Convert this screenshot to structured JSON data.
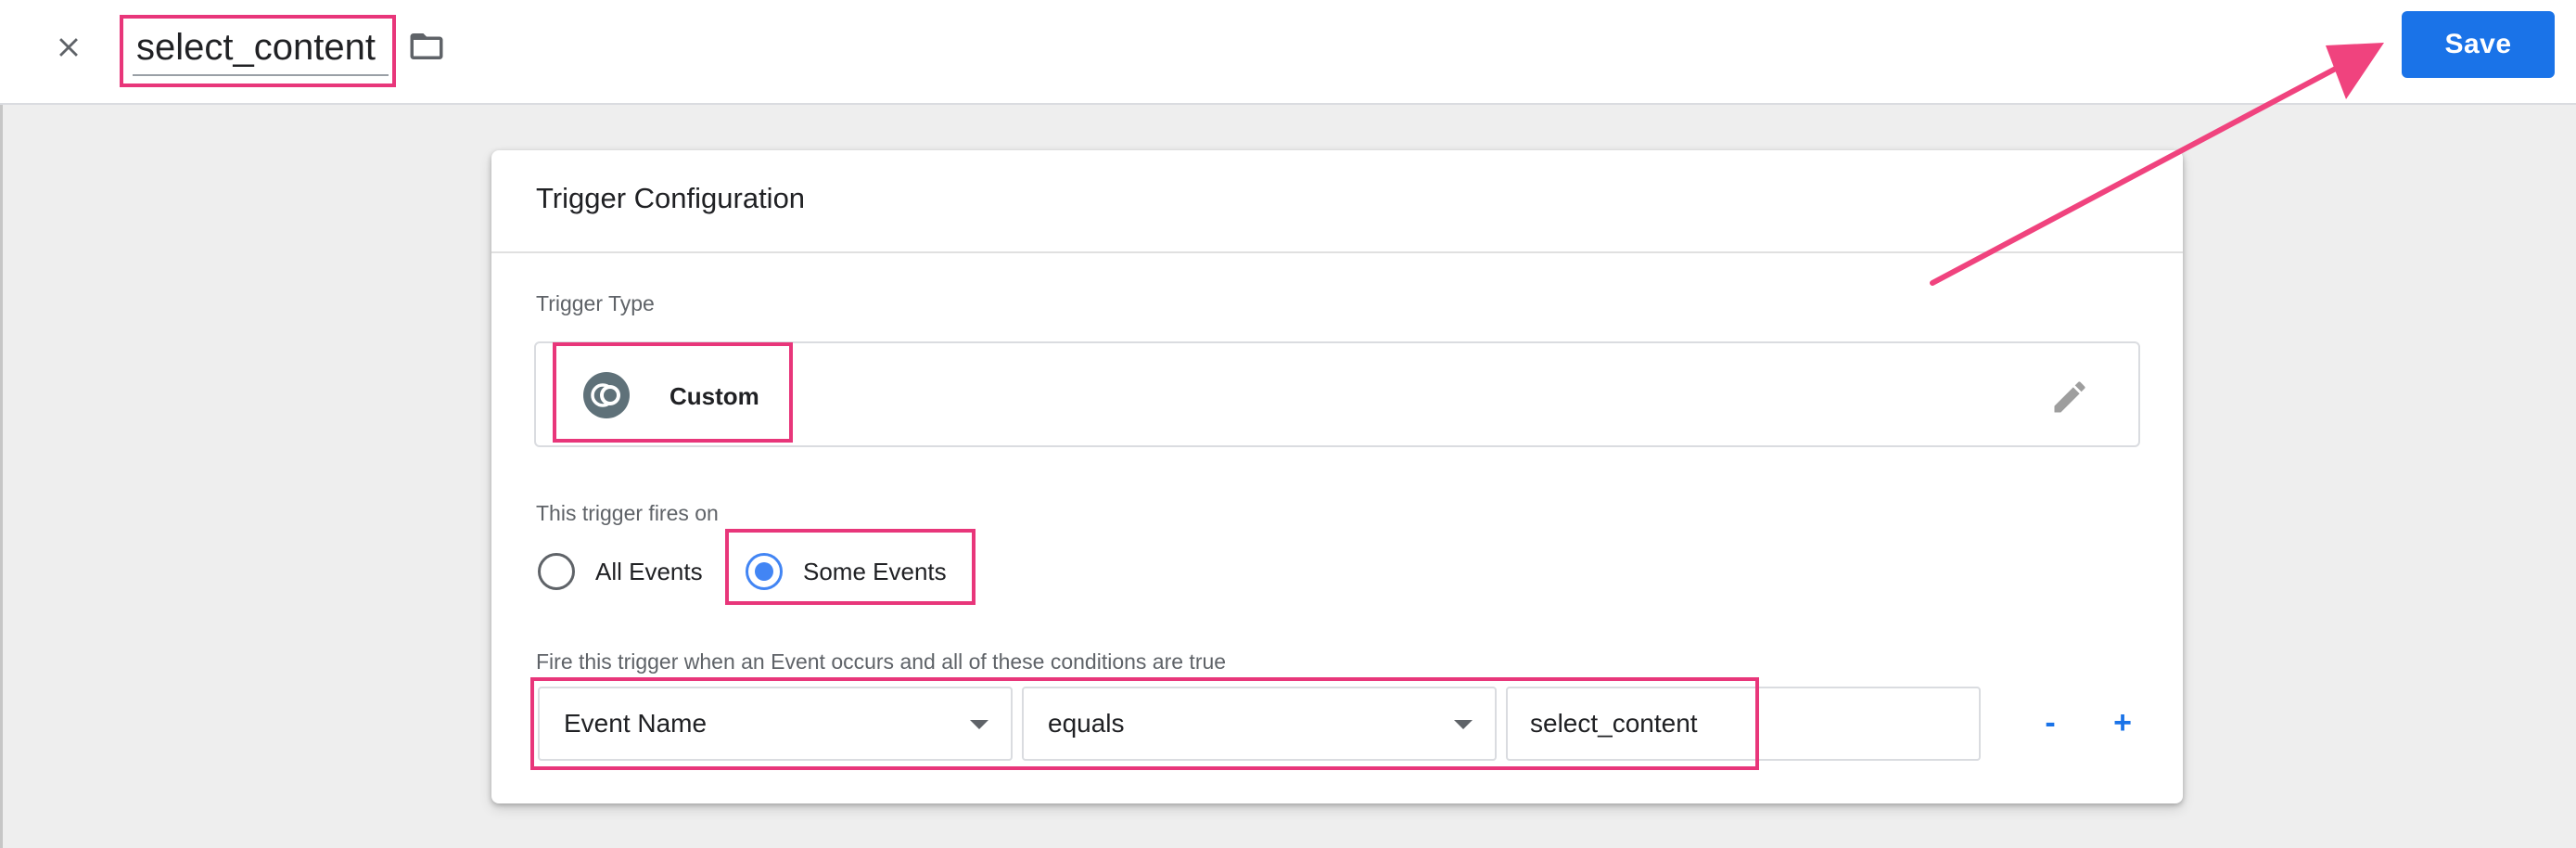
{
  "header": {
    "title_value": "select_content",
    "save_label": "Save",
    "icons": {
      "close": "close-icon",
      "folder": "folder-icon"
    }
  },
  "card": {
    "title": "Trigger Configuration",
    "trigger_type_label": "Trigger Type",
    "trigger_type_name": "Custom",
    "fires_on_label": "This trigger fires on",
    "fires_on_options": [
      {
        "label": "All Events",
        "selected": false
      },
      {
        "label": "Some Events",
        "selected": true
      }
    ],
    "conditions_label": "Fire this trigger when an Event occurs and all of these conditions are true",
    "condition": {
      "variable": "Event Name",
      "operator": "equals",
      "value": "select_content"
    },
    "remove_label": "-",
    "add_label": "+"
  },
  "colors": {
    "accent": "#1a73e8",
    "radio_selected": "#4285f4",
    "annotation": "#e8367a",
    "trigger_icon": "#5f7179"
  }
}
